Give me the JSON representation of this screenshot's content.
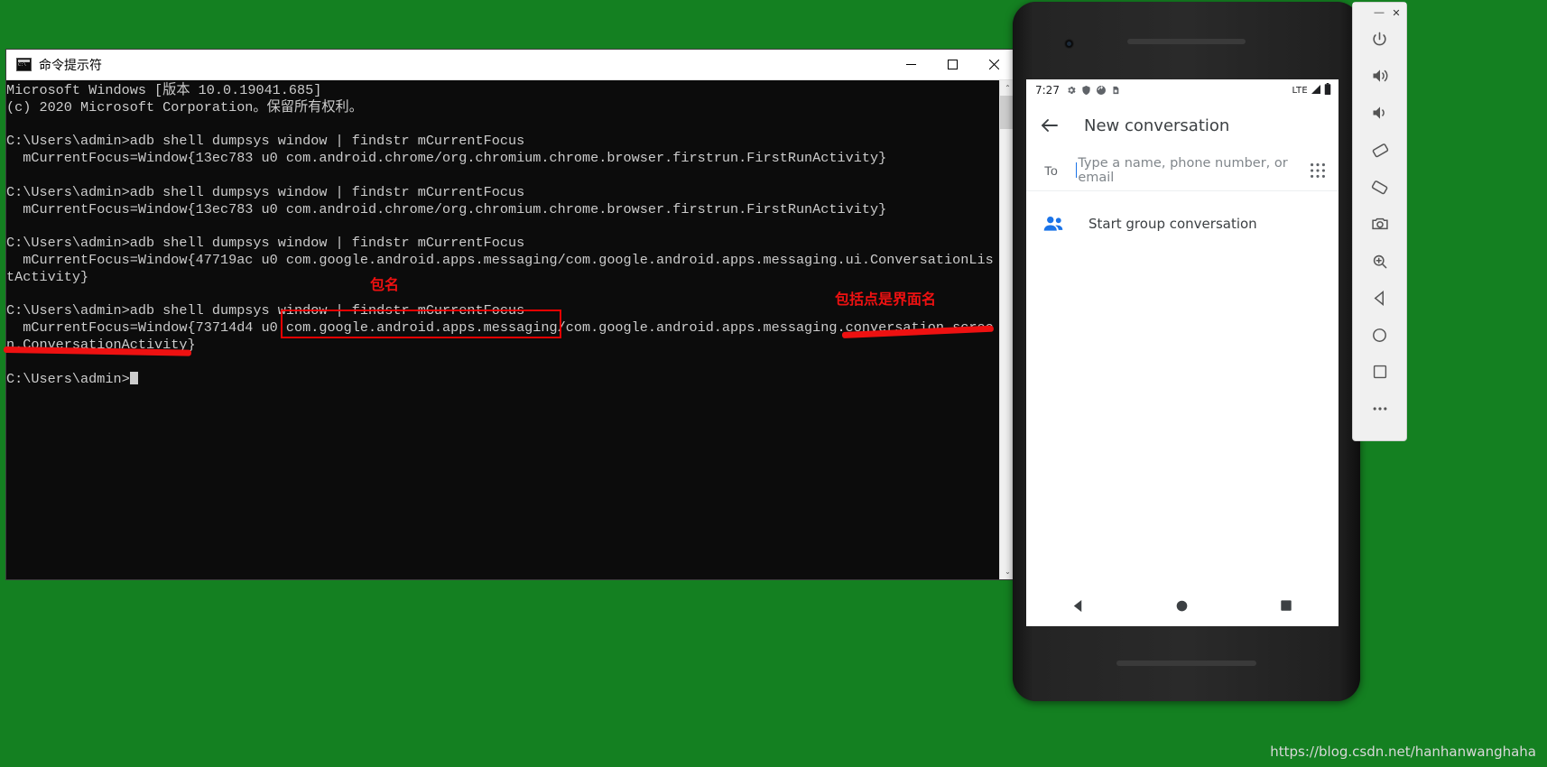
{
  "desktop": {
    "background_color": "#148021"
  },
  "cmd": {
    "title": "命令提示符",
    "icon_name": "cmd-icon",
    "minimize_label": "—",
    "maximize_label": "☐",
    "close_label": "✕",
    "lines": [
      "Microsoft Windows [版本 10.0.19041.685]",
      "(c) 2020 Microsoft Corporation。保留所有权利。",
      "",
      "C:\\Users\\admin>adb shell dumpsys window | findstr mCurrentFocus",
      "  mCurrentFocus=Window{13ec783 u0 com.android.chrome/org.chromium.chrome.browser.firstrun.FirstRunActivity}",
      "",
      "C:\\Users\\admin>adb shell dumpsys window | findstr mCurrentFocus",
      "  mCurrentFocus=Window{13ec783 u0 com.android.chrome/org.chromium.chrome.browser.firstrun.FirstRunActivity}",
      "",
      "C:\\Users\\admin>adb shell dumpsys window | findstr mCurrentFocus",
      "  mCurrentFocus=Window{47719ac u0 com.google.android.apps.messaging/com.google.android.apps.messaging.ui.ConversationLis",
      "tActivity}",
      "",
      "C:\\Users\\admin>adb shell dumpsys window | findstr mCurrentFocus",
      "  mCurrentFocus=Window{73714d4 u0 com.google.android.apps.messaging/com.google.android.apps.messaging.conversation.scree",
      "n.ConversationActivity}",
      "",
      "C:\\Users\\admin>"
    ],
    "scrollbar": {
      "up_arrow": "⌃",
      "down_arrow": "⌄"
    }
  },
  "annotations": {
    "accent_color": "#ee1111",
    "package_label": "包名",
    "activity_label": "包括点是界面名"
  },
  "emulator": {
    "status_bar": {
      "time": "7:27",
      "icons": [
        "gear-icon",
        "shield-icon",
        "sync-icon",
        "sim-icon"
      ],
      "network": "LTE",
      "signal_icon": "signal-icon",
      "battery_icon": "battery-icon"
    },
    "app_bar": {
      "back_icon": "back-arrow-icon",
      "title": "New conversation"
    },
    "to_row": {
      "label": "To",
      "value": "",
      "placeholder": "Type a name, phone number, or email",
      "dialpad_icon": "dialpad-icon"
    },
    "group_row": {
      "icon": "group-people-icon",
      "label": "Start group conversation"
    },
    "nav_bar": {
      "back": "nav-back-triangle-icon",
      "home": "nav-home-circle-icon",
      "recents": "nav-recents-square-icon"
    }
  },
  "emulator_toolbar": {
    "minimize_label": "—",
    "close_label": "✕",
    "items": [
      "power-icon",
      "volume-up-icon",
      "volume-down-icon",
      "rotate-left-icon",
      "rotate-right-icon",
      "camera-icon",
      "zoom-icon",
      "nav-back-icon",
      "nav-home-icon",
      "nav-overview-icon",
      "more-icon"
    ]
  },
  "watermark": {
    "text": "https://blog.csdn.net/hanhanwanghaha"
  }
}
